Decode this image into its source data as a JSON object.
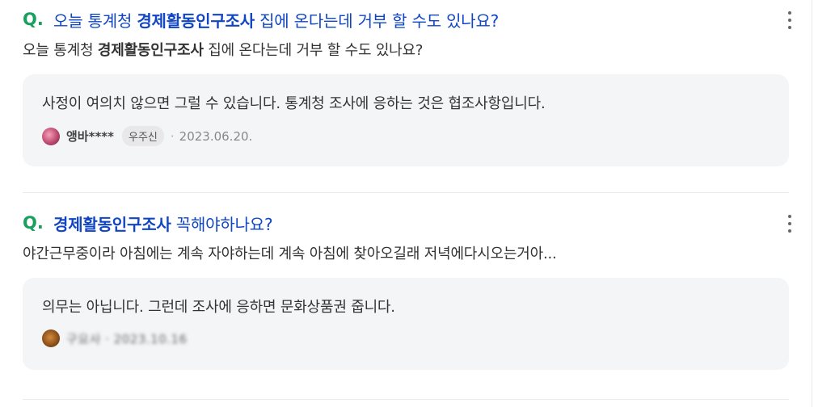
{
  "results": [
    {
      "q_mark": "Q.",
      "title_pre": "오늘 통계청 ",
      "title_bold": "경제활동인구조사",
      "title_post": " 집에 온다는데 거부 할 수도 있나요?",
      "body_pre": "오늘 통계청 ",
      "body_bold": "경제활동인구조사",
      "body_post": " 집에 온다는데 거부 할 수도 있나요?",
      "answer_text": "사정이 여의치 않으면 그럴 수 있습니다. 통계청 조사에 응하는 것은 협조사항입니다.",
      "author": "앵바****",
      "badge": "우주신",
      "date": "2023.06.20."
    },
    {
      "q_mark": "Q.",
      "title_bold": "경제활동인구조사",
      "title_post": " 꼭해야하나요?",
      "body_text": "야간근무중이라 아침에는 계속 자야하는데 계속 아침에 찾아오길래 저녁에다시오는거아...",
      "answer_text": "의무는 아닙니다. 그런데 조사에 응하면 문화상품권 줍니다.",
      "author_blurred": "구요사 · 2023.10.16"
    }
  ],
  "icons": {
    "more": "more-vertical-icon",
    "avatar": "avatar-icon"
  },
  "colors": {
    "title": "#1045c4",
    "q_mark": "#1aa05e",
    "answer_bg": "#f4f5f7"
  }
}
